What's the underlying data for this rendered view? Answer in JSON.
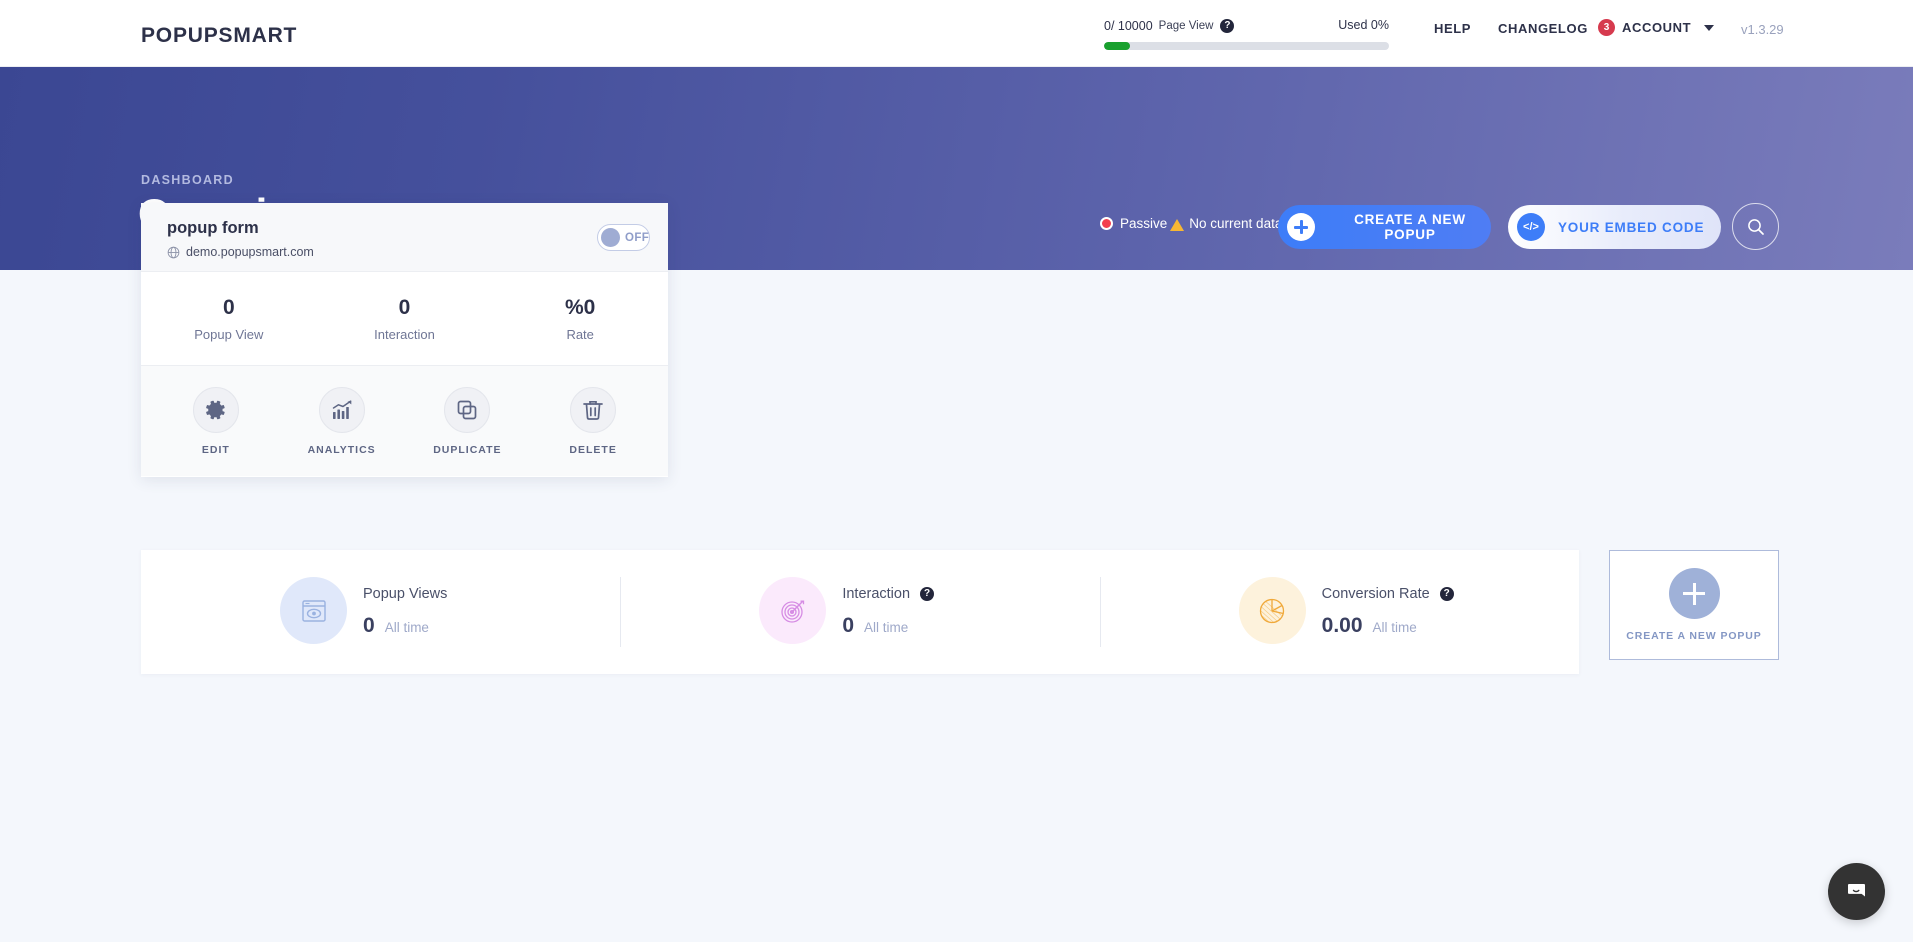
{
  "topbar": {
    "logo": "POPUPSMART",
    "usage": {
      "count": "0/ 10000",
      "label": "Page View",
      "help_icon": "question-mark-icon",
      "used": "Used 0%",
      "progress_percent": 0,
      "fill_color": "#19a02e",
      "track_color": "#dcdfe6"
    },
    "nav": {
      "help": "HELP",
      "changelog": "CHANGELOG",
      "account": "ACCOUNT",
      "account_badge": "3",
      "account_badge_color": "#d63a4e",
      "caret_icon": "chevron-down-icon",
      "version": "v1.3.29"
    }
  },
  "hero": {
    "kicker": "DASHBOARD",
    "title": "Overview",
    "gradient_from": "#3b4793",
    "gradient_to": "#7a7cbb",
    "status": {
      "dot_icon": "record-dot-icon",
      "dot_color": "#f23f4f",
      "state": "Passive",
      "warning_icon": "warning-triangle-icon",
      "warning_color": "#f7b733",
      "message": "No current data"
    },
    "create_button": {
      "label": "CREATE A NEW POPUP",
      "icon": "plus-icon",
      "color": "#3d7df8"
    },
    "embed_button": {
      "label": "YOUR EMBED CODE",
      "icon": "code-brackets-icon",
      "color": "#3d7df8"
    },
    "search_button": {
      "icon": "search-icon"
    }
  },
  "popup_card": {
    "title": "popup form",
    "url": "demo.popupsmart.com",
    "url_icon": "globe-icon",
    "toggle": {
      "state": "OFF",
      "enabled": false
    },
    "stats": [
      {
        "value": "0",
        "label": "Popup View"
      },
      {
        "value": "0",
        "label": "Interaction"
      },
      {
        "value": "%0",
        "label": "Rate"
      }
    ],
    "actions": [
      {
        "label": "EDIT",
        "icon": "gear-icon"
      },
      {
        "label": "ANALYTICS",
        "icon": "bar-chart-icon"
      },
      {
        "label": "DUPLICATE",
        "icon": "copy-icon"
      },
      {
        "label": "DELETE",
        "icon": "trash-icon"
      }
    ]
  },
  "stats_bar": {
    "cells": [
      {
        "title": "Popup Views",
        "value": "0",
        "subtitle": "All time",
        "icon": "browser-eye-icon",
        "has_help": false,
        "accent": "#e0e8fa"
      },
      {
        "title": "Interaction",
        "value": "0",
        "subtitle": "All time",
        "icon": "target-dart-icon",
        "has_help": true,
        "help_icon": "question-mark-icon",
        "accent": "#fbeafc"
      },
      {
        "title": "Conversion Rate",
        "value": "0.00",
        "subtitle": "All time",
        "icon": "pie-chart-icon",
        "has_help": true,
        "help_icon": "question-mark-icon",
        "accent": "#fdf2dc"
      }
    ],
    "help_glyph": "?"
  },
  "create_tile": {
    "label": "CREATE A NEW POPUP",
    "icon": "plus-icon"
  },
  "intercom": {
    "icon": "chat-bubble-icon"
  }
}
